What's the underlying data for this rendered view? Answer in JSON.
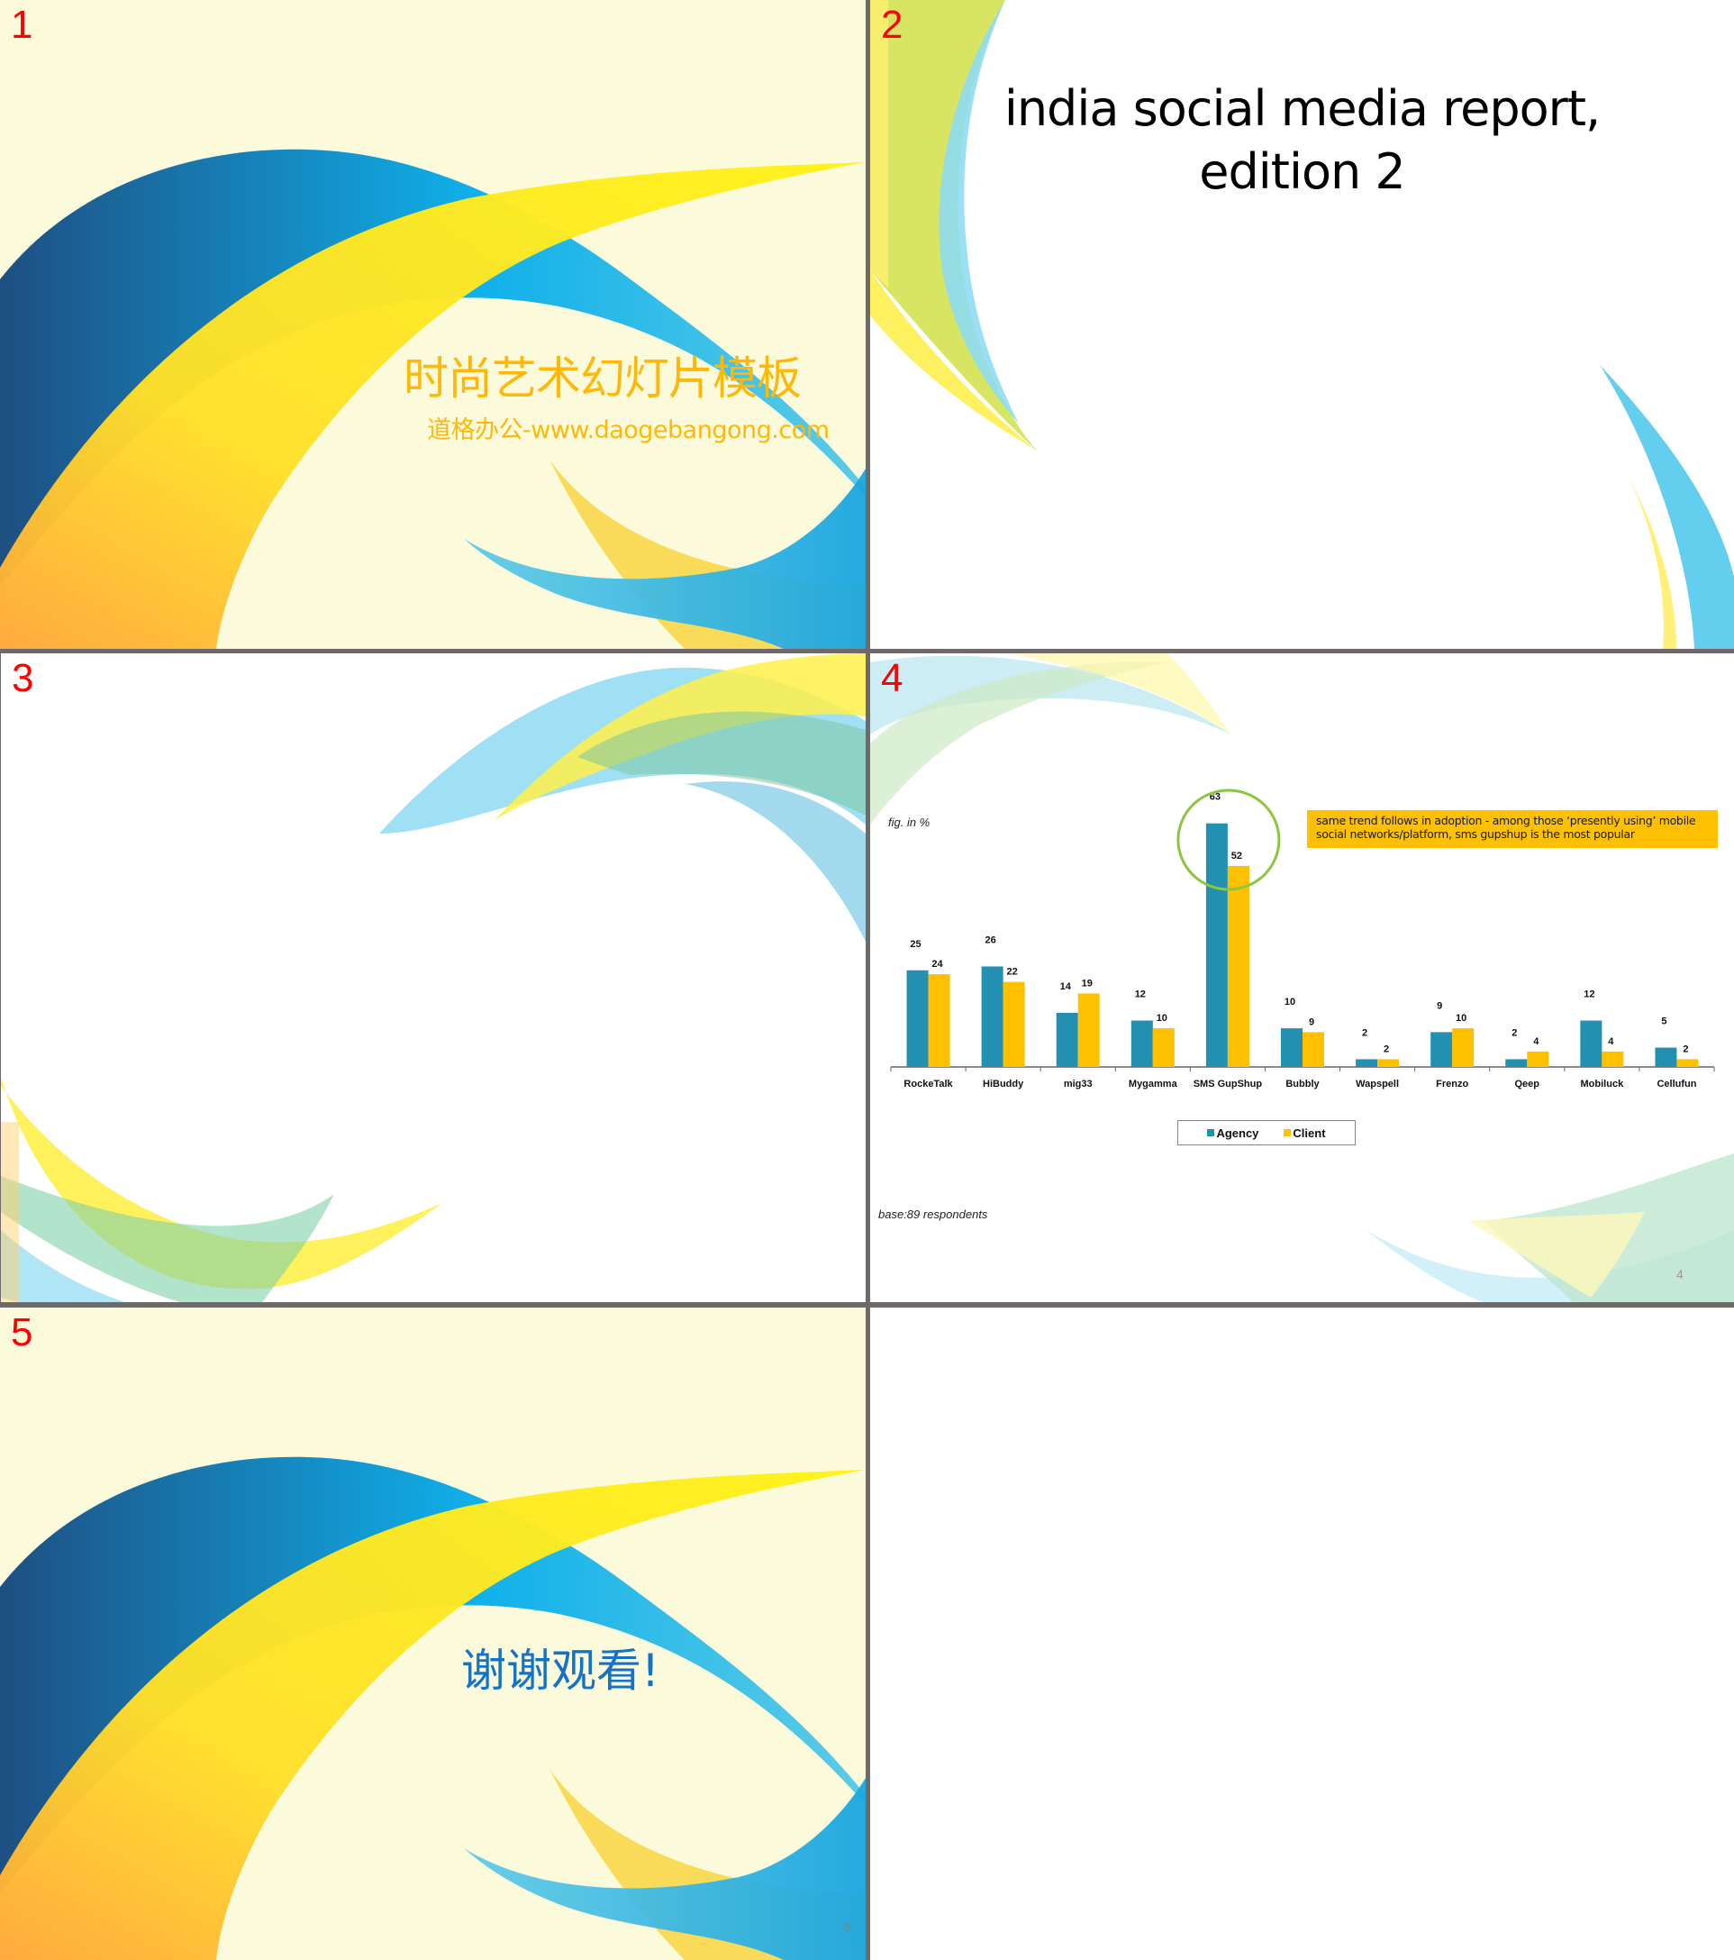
{
  "slides": [
    {
      "number": "1",
      "title": "时尚艺术幻灯片模板",
      "subtitle": "道格办公-www.daogebangong.com"
    },
    {
      "number": "2",
      "title_line1": "india social media report,",
      "title_line2": "edition 2"
    },
    {
      "number": "3"
    },
    {
      "number": "4",
      "fig_note": "fig. in %",
      "callout": "same trend follows  in adoption  - among those ‘presently  using’ mobile social networks/platform,  sms gupshup  is the most popular",
      "base_note": "base:89 respondents",
      "page_number": "4"
    },
    {
      "number": "5",
      "title": "谢谢观看!",
      "page_number": "5"
    }
  ],
  "colors": {
    "agency": "#2390b2",
    "client": "#ffc000",
    "highlight_circle": "#8cc63f",
    "slide_number": "#ff0000",
    "title_orange": "#ffb80a",
    "thanks_blue": "#1473c4"
  },
  "chart_data": {
    "type": "bar",
    "title": "",
    "xlabel": "",
    "ylabel": "fig. in %",
    "categories": [
      "RockeTalk",
      "HiBuddy",
      "mig33",
      "Mygamma",
      "SMS GupShup",
      "Bubbly",
      "Wapspell",
      "Frenzo",
      "Qeep",
      "Mobiluck",
      "Cellufun"
    ],
    "series": [
      {
        "name": "Agency",
        "values": [
          25,
          26,
          14,
          12,
          63,
          10,
          2,
          9,
          2,
          12,
          5
        ]
      },
      {
        "name": "Client",
        "values": [
          24,
          22,
          19,
          10,
          52,
          9,
          2,
          10,
          4,
          4,
          2
        ]
      }
    ],
    "ylim": [
      0,
      63
    ],
    "grid": false,
    "legend": {
      "position": "bottom",
      "entries": [
        "Agency",
        "Client"
      ]
    },
    "highlight": {
      "category": "SMS GupShup",
      "shape": "circle"
    },
    "annotations": [
      "same trend follows in adoption - among those ‘presently using’ mobile social networks/platform, sms gupshup is the most popular",
      "base:89 respondents"
    ]
  }
}
